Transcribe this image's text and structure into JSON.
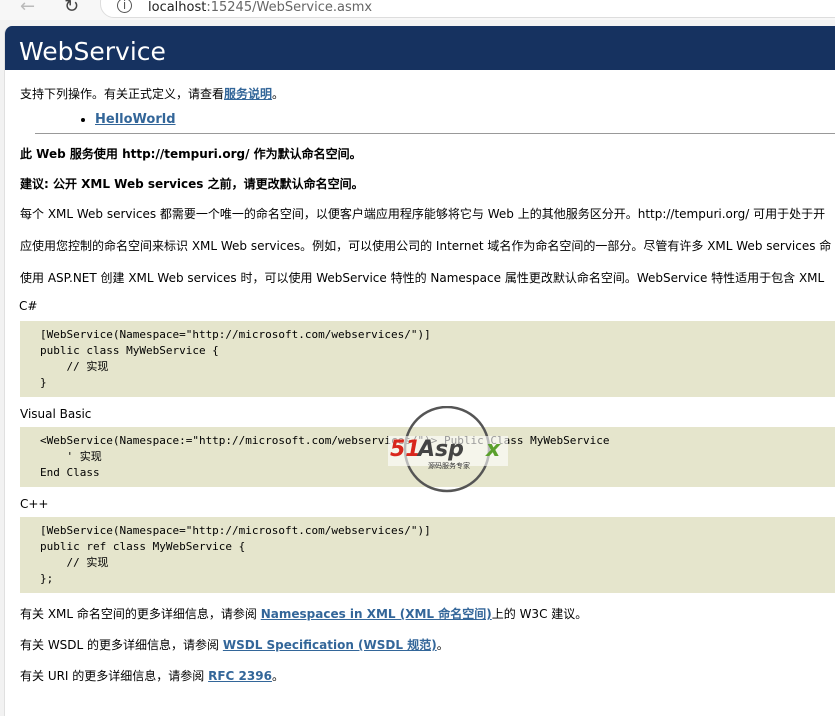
{
  "browser": {
    "url_host": "localhost",
    "url_rest": ":15245/WebService.asmx"
  },
  "header": {
    "title": "WebService"
  },
  "intro": {
    "text": "支持下列操作。有关正式定义，请查看",
    "link": "服务说明",
    "end": "。"
  },
  "operations": [
    {
      "label": "HelloWorld"
    }
  ],
  "notice": {
    "line1": "此 Web 服务使用 http://tempuri.org/ 作为默认命名空间。",
    "line2": "建议: 公开 XML Web services 之前，请更改默认命名空间。",
    "p1": "每个 XML Web services 都需要一个唯一的命名空间，以便客户端应用程序能够将它与 Web 上的其他服务区分开。http://tempuri.org/ 可用于处于开",
    "p2": "应使用您控制的命名空间来标识 XML Web services。例如，可以使用公司的 Internet 域名作为命名空间的一部分。尽管有许多 XML Web services 命",
    "p3": "使用 ASP.NET 创建 XML Web services 时，可以使用 WebService 特性的 Namespace 属性更改默认命名空间。WebService 特性适用于包含 XML"
  },
  "samples": [
    {
      "lang": "C#",
      "code": "[WebService(Namespace=\"http://microsoft.com/webservices/\")]\npublic class MyWebService {\n    // 实现\n}"
    },
    {
      "lang": "Visual Basic",
      "code": "<WebService(Namespace:=\"http://microsoft.com/webservices/\")> Public Class MyWebService\n    ' 实现\nEnd Class"
    },
    {
      "lang": "C++",
      "code": "[WebService(Namespace=\"http://microsoft.com/webservices/\")]\npublic ref class MyWebService {\n    // 实现\n};"
    }
  ],
  "more": [
    {
      "pre": "有关 XML 命名空间的更多详细信息，请参阅 ",
      "link": "Namespaces in XML (XML 命名空间)",
      "post": "上的 W3C 建议。"
    },
    {
      "pre": "有关 WSDL 的更多详细信息，请参阅 ",
      "link": "WSDL Specification (WSDL 规范)",
      "post": "。"
    },
    {
      "pre": "有关 URI 的更多详细信息，请参阅 ",
      "link": "RFC 2396",
      "post": "。"
    }
  ],
  "watermark": {
    "brand": "51Aspx",
    "tagline": "源码服务专家"
  }
}
